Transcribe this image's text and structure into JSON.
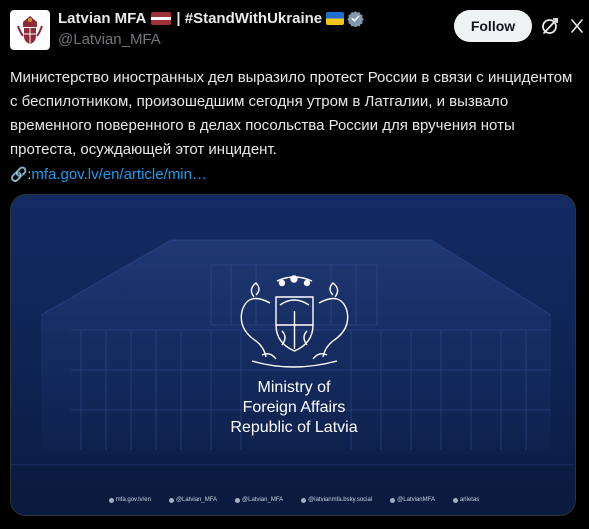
{
  "account": {
    "display_name": "Latvian MFA",
    "display_suffix": "| #StandWithUkraine",
    "handle": "@Latvian_MFA",
    "flag_icons": [
      "latvia-flag-icon",
      "ukraine-flag-icon"
    ],
    "badge_icon": "verified-badge-icon"
  },
  "actions": {
    "follow_label": "Follow",
    "grok_icon": "grok-icon",
    "more_icon": "more-options-icon"
  },
  "tweet": {
    "text": "Министерство иностранных дел выразило протест России в связи с инцидентом с беспилотником, произошедшим сегодня утром в Латгалии, и вызвало временного поверенного в делах посольства России для вручения ноты протеста, осуждающей этот инцидент.",
    "link_emoji": "🔗:",
    "link_text": "mfa.gov.lv/en/article/min…"
  },
  "media": {
    "lines": [
      "Ministry of",
      "Foreign Affairs",
      "Republic of Latvia"
    ],
    "footer": [
      "mfa.gov.lv/en",
      "@Latvian_MFA",
      "@Latvian_MFA",
      "@latvianmfa.bsky.social",
      "@LatvianMFA",
      "arlietas"
    ]
  },
  "colors": {
    "background": "#000000",
    "text": "#e7e9ea",
    "secondary": "#71767b",
    "link": "#1d9bf0",
    "verified": "#829aab",
    "media_blue": "#142a63"
  }
}
